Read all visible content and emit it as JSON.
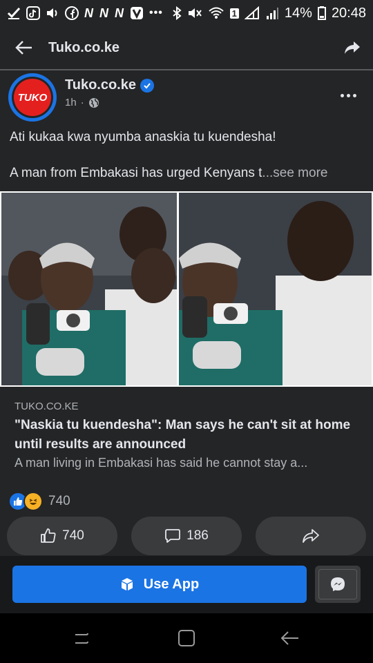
{
  "status_bar": {
    "battery_percent": "14%",
    "time": "20:48",
    "sim_slot": "1",
    "left_icons": [
      "check-icon",
      "tiktok-icon",
      "volume-icon",
      "facebook-icon",
      "netflix-icon",
      "netflix-icon",
      "netflix-icon",
      "vpn-icon",
      "more-dots-icon"
    ],
    "right_icons": [
      "bluetooth-icon",
      "mute-icon",
      "wifi-icon",
      "signal-icon",
      "signal-icon",
      "battery-icon"
    ]
  },
  "app_bar": {
    "title": "Tuko.co.ke"
  },
  "post": {
    "page_name": "Tuko.co.ke",
    "avatar_text": "TUKO",
    "time_ago": "1h",
    "dot": "·",
    "text_line1": "Ati kukaa kwa nyumba anaskia tu kuendesha!",
    "text_line2": "A man from Embakasi has urged Kenyans t",
    "see_more": "...see more",
    "link": {
      "domain": "TUKO.CO.KE",
      "title": "\"Naskia tu kuendesha\": Man says he can't sit at home until results are announced",
      "description": "A man living in Embakasi has said he cannot stay a..."
    },
    "reactions_count": "740",
    "actions": {
      "likes": "740",
      "comments": "186"
    }
  },
  "footer": {
    "use_app_label": "Use App"
  },
  "colors": {
    "background": "#242526",
    "accent": "#1b74e4",
    "brand_red": "#e4201f",
    "text_primary": "#e4e6eb",
    "text_secondary": "#b0b3b8"
  }
}
